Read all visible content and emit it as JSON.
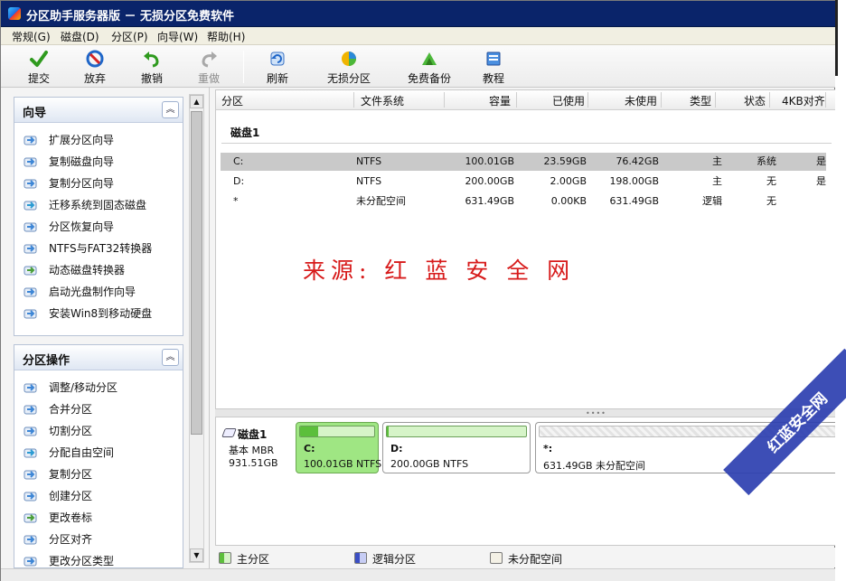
{
  "window": {
    "title": "分区助手服务器版 － 无损分区免费软件"
  },
  "menu": [
    "常规(G)",
    "磁盘(D)",
    "分区(P)",
    "向导(W)",
    "帮助(H)"
  ],
  "toolbar": {
    "commit": "提交",
    "discard": "放弃",
    "undo": "撤销",
    "redo": "重做",
    "refresh": "刷新",
    "lossless": "无损分区",
    "backup": "免费备份",
    "tutorial": "教程"
  },
  "wizard": {
    "title": "向导",
    "items": [
      "扩展分区向导",
      "复制磁盘向导",
      "复制分区向导",
      "迁移系统到固态磁盘",
      "分区恢复向导",
      "NTFS与FAT32转换器",
      "动态磁盘转换器",
      "启动光盘制作向导",
      "安装Win8到移动硬盘"
    ]
  },
  "operations": {
    "title": "分区操作",
    "items": [
      "调整/移动分区",
      "合并分区",
      "切割分区",
      "分配自由空间",
      "复制分区",
      "创建分区",
      "更改卷标",
      "分区对齐",
      "更改分区类型"
    ]
  },
  "columns": [
    "分区",
    "文件系统",
    "容量",
    "已使用",
    "未使用",
    "类型",
    "状态",
    "4KB对齐"
  ],
  "disk": {
    "name": "磁盘1",
    "type": "基本 MBR",
    "size": "931.51GB"
  },
  "partitions": [
    {
      "name": "C:",
      "fs": "NTFS",
      "capacity": "100.01GB",
      "used": "23.59GB",
      "free": "76.42GB",
      "type": "主",
      "status": "系统",
      "aligned": "是"
    },
    {
      "name": "D:",
      "fs": "NTFS",
      "capacity": "200.00GB",
      "used": "2.00GB",
      "free": "198.00GB",
      "type": "主",
      "status": "无",
      "aligned": "是"
    },
    {
      "name": "*",
      "fs": "未分配空间",
      "capacity": "631.49GB",
      "used": "0.00KB",
      "free": "631.49GB",
      "type": "逻辑",
      "status": "无",
      "aligned": ""
    }
  ],
  "map": [
    {
      "label": "C:",
      "info": "100.01GB NTFS",
      "used_fraction": 0.24
    },
    {
      "label": "D:",
      "info": "200.00GB NTFS",
      "used_fraction": 0.01
    },
    {
      "label": "*:",
      "info": "631.49GB 未分配空间",
      "used_fraction": 0
    }
  ],
  "legend": [
    "主分区",
    "逻辑分区",
    "未分配空间"
  ],
  "watermark": "来源: 红 蓝 安 全 网",
  "stamp": "红蓝安全网",
  "colors": {
    "titlebar": "#0a246a",
    "selected_row": "#c9c9c9",
    "primary": "#5cbf3b",
    "logical": "#3b4fc4",
    "unallocated": "#f4f1e6",
    "watermark": "#d71a1a"
  }
}
